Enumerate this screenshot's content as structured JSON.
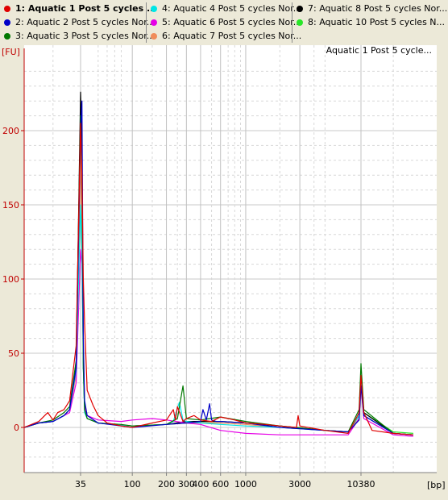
{
  "legend": {
    "items": [
      {
        "label": "1: Aquatic 1 Post 5 cycles ...",
        "color": "#e00000",
        "bold": true
      },
      {
        "label": "2: Aquatic 2 Post 5 cycles Nor...",
        "color": "#0000c8",
        "bold": false
      },
      {
        "label": "3: Aquatic 3 Post 5 cycles Nor...",
        "color": "#007800",
        "bold": false
      },
      {
        "label": "4: Aquatic 4 Post 5 cycles Nor...",
        "color": "#00e6e6",
        "bold": false
      },
      {
        "label": "5: Aquatic 6 Post 5 cycles Nor...",
        "color": "#e600e6",
        "bold": false
      },
      {
        "label": "6: Aquatic 7 Post 5 cycles Nor...",
        "color": "#f08c5a",
        "bold": false
      },
      {
        "label": "7: Aquatic 8 Post 5 cycles Nor...",
        "color": "#000000",
        "bold": false
      },
      {
        "label": "8: Aquatic 10 Post 5 cycles N...",
        "color": "#28e628",
        "bold": false
      }
    ]
  },
  "chart_data": {
    "type": "line",
    "title": "Aquatic 1 Post 5 cycle...",
    "ylabel": "[FU]",
    "xlabel": "[bp]",
    "y_ticks": [
      "0",
      "50",
      "100",
      "150",
      "200"
    ],
    "x_ticks": [
      "35",
      "100",
      "200",
      "300",
      "400",
      "600",
      "1000",
      "3000",
      "10380"
    ],
    "ylim": [
      -30,
      250
    ],
    "x_scale": "log",
    "xlim": [
      10,
      30000
    ],
    "grid": true,
    "series": [
      {
        "name": "1: Aquatic 1 Post 5 cycles ...",
        "color": "#e00000",
        "x": [
          10,
          15,
          18,
          20,
          22,
          25,
          28,
          32,
          35,
          36,
          37,
          38,
          40,
          45,
          50,
          60,
          80,
          100,
          150,
          200,
          230,
          240,
          250,
          280,
          300,
          350,
          400,
          500,
          600,
          700,
          800,
          1000,
          1500,
          2000,
          2800,
          2900,
          3000,
          5000,
          8000,
          10000,
          10380,
          11000,
          13000,
          20000,
          30000
        ],
        "y": [
          0,
          4,
          10,
          5,
          10,
          12,
          18,
          55,
          205,
          170,
          100,
          70,
          25,
          15,
          8,
          3,
          1,
          0,
          3,
          5,
          12,
          5,
          14,
          4,
          6,
          8,
          5,
          4,
          7,
          6,
          5,
          3,
          2,
          1,
          0,
          8,
          1,
          -2,
          -4,
          10,
          35,
          10,
          -2,
          -4,
          -5
        ]
      },
      {
        "name": "2: Aquatic 2 Post 5 cycles Nor...",
        "color": "#0000c8",
        "x": [
          10,
          15,
          20,
          25,
          28,
          32,
          35,
          36,
          37,
          38,
          40,
          50,
          80,
          100,
          200,
          300,
          400,
          420,
          450,
          480,
          500,
          550,
          600,
          1000,
          2000,
          5000,
          8000,
          10000,
          10380,
          11000,
          20000,
          30000
        ],
        "y": [
          0,
          3,
          4,
          8,
          12,
          40,
          200,
          220,
          60,
          18,
          8,
          3,
          1,
          0,
          2,
          3,
          4,
          12,
          5,
          16,
          5,
          4,
          4,
          3,
          0,
          -2,
          -3,
          5,
          28,
          8,
          -4,
          -5
        ]
      },
      {
        "name": "3: Aquatic 3 Post 5 cycles Nor...",
        "color": "#007800",
        "x": [
          10,
          15,
          20,
          25,
          28,
          32,
          35,
          36,
          37,
          38,
          40,
          50,
          80,
          100,
          200,
          250,
          280,
          300,
          400,
          600,
          1000,
          2000,
          5000,
          8000,
          10000,
          10380,
          11000,
          20000,
          30000
        ],
        "y": [
          0,
          3,
          5,
          10,
          14,
          45,
          210,
          175,
          40,
          12,
          6,
          3,
          2,
          1,
          2,
          6,
          28,
          6,
          5,
          7,
          4,
          1,
          -2,
          -3,
          12,
          43,
          12,
          -4,
          -5
        ]
      },
      {
        "name": "4: Aquatic 4 Post 5 cycles Nor...",
        "color": "#00e6e6",
        "x": [
          10,
          15,
          20,
          25,
          28,
          32,
          35,
          36,
          37,
          38,
          40,
          50,
          100,
          200,
          230,
          260,
          280,
          300,
          400,
          600,
          1000,
          2000,
          5000,
          8000,
          10000,
          10380,
          11000,
          20000,
          30000
        ],
        "y": [
          0,
          3,
          4,
          8,
          12,
          38,
          150,
          120,
          40,
          10,
          6,
          3,
          1,
          2,
          4,
          17,
          5,
          4,
          3,
          2,
          1,
          0,
          -2,
          -3,
          8,
          30,
          8,
          -4,
          -5
        ]
      },
      {
        "name": "5: Aquatic 6 Post 5 cycles Nor...",
        "color": "#e600e6",
        "x": [
          10,
          15,
          20,
          25,
          28,
          32,
          35,
          36,
          37,
          38,
          40,
          50,
          80,
          100,
          150,
          200,
          300,
          400,
          600,
          1000,
          2000,
          3000,
          5000,
          8000,
          10000,
          10380,
          11000,
          20000,
          30000
        ],
        "y": [
          0,
          3,
          4,
          8,
          10,
          30,
          120,
          110,
          50,
          15,
          8,
          5,
          4,
          5,
          6,
          5,
          3,
          2,
          -2,
          -4,
          -5,
          -5,
          -5,
          -5,
          6,
          28,
          6,
          -5,
          -6
        ]
      },
      {
        "name": "6: Aquatic 7 Post 5 cycles Nor...",
        "color": "#f08c5a",
        "x": [
          10,
          15,
          20,
          25,
          28,
          32,
          35,
          36,
          37,
          38,
          40,
          50,
          100,
          200,
          300,
          400,
          600,
          1000,
          2000,
          5000,
          8000,
          10000,
          10380,
          11000,
          20000,
          30000
        ],
        "y": [
          0,
          3,
          4,
          8,
          12,
          35,
          180,
          140,
          45,
          12,
          6,
          3,
          1,
          2,
          3,
          3,
          3,
          2,
          0,
          -2,
          -3,
          6,
          28,
          8,
          -4,
          -5
        ]
      },
      {
        "name": "7: Aquatic 8 Post 5 cycles Nor...",
        "color": "#000000",
        "x": [
          10,
          15,
          20,
          25,
          28,
          32,
          35,
          36,
          37,
          38,
          40,
          50,
          100,
          200,
          300,
          400,
          600,
          1000,
          2000,
          5000,
          8000,
          10000,
          10380,
          11000,
          20000,
          30000
        ],
        "y": [
          0,
          3,
          4,
          8,
          12,
          42,
          226,
          190,
          45,
          12,
          6,
          3,
          1,
          2,
          4,
          4,
          4,
          3,
          1,
          -2,
          -3,
          8,
          34,
          10,
          -4,
          -5
        ]
      },
      {
        "name": "8: Aquatic 10 Post 5 cycles N...",
        "color": "#28e628",
        "x": [
          10,
          15,
          20,
          25,
          28,
          32,
          35,
          36,
          37,
          38,
          40,
          50,
          100,
          200,
          300,
          400,
          600,
          1000,
          2000,
          5000,
          8000,
          10000,
          10380,
          11000,
          20000,
          30000
        ],
        "y": [
          0,
          3,
          4,
          8,
          12,
          40,
          200,
          160,
          42,
          12,
          6,
          3,
          1,
          2,
          3,
          4,
          4,
          3,
          1,
          -2,
          -3,
          8,
          33,
          10,
          -3,
          -4
        ]
      }
    ]
  }
}
